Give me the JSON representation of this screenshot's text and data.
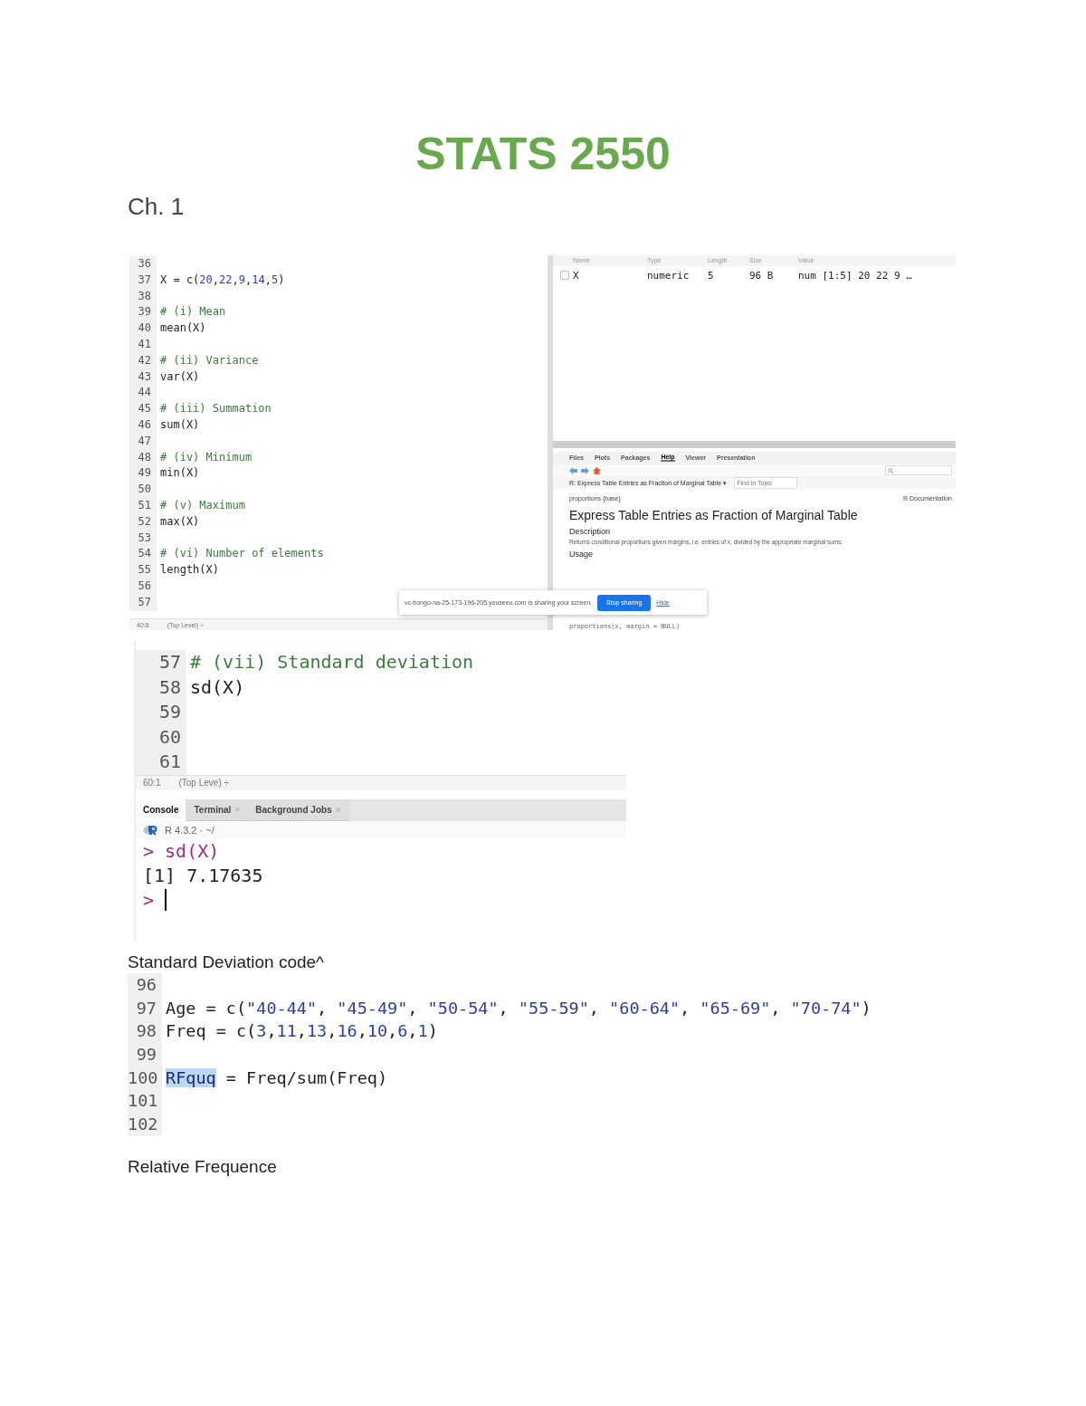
{
  "title": "STATS 2550",
  "chapter": "Ch. 1",
  "shot1": {
    "editor": {
      "lines": [
        {
          "number": "36"
        },
        {
          "number": "37",
          "tokens": [
            {
              "text": "X = c(",
              "kind": "plain"
            },
            {
              "text": "20",
              "kind": "num"
            },
            {
              "text": ",",
              "kind": "plain"
            },
            {
              "text": "22",
              "kind": "num"
            },
            {
              "text": ",",
              "kind": "plain"
            },
            {
              "text": "9",
              "kind": "num"
            },
            {
              "text": ",",
              "kind": "plain"
            },
            {
              "text": "14",
              "kind": "num"
            },
            {
              "text": ",",
              "kind": "plain"
            },
            {
              "text": "5",
              "kind": "num"
            },
            {
              "text": ")",
              "kind": "plain"
            }
          ]
        },
        {
          "number": "38"
        },
        {
          "number": "39",
          "tokens": [
            {
              "text": "# (i) Mean",
              "kind": "comment"
            }
          ]
        },
        {
          "number": "40",
          "tokens": [
            {
              "text": "mean(X)",
              "kind": "plain"
            }
          ]
        },
        {
          "number": "41"
        },
        {
          "number": "42",
          "tokens": [
            {
              "text": "# (ii) Variance",
              "kind": "comment"
            }
          ]
        },
        {
          "number": "43",
          "tokens": [
            {
              "text": "var(X)",
              "kind": "plain"
            }
          ]
        },
        {
          "number": "44"
        },
        {
          "number": "45",
          "tokens": [
            {
              "text": "# (iii) Summation",
              "kind": "comment"
            }
          ]
        },
        {
          "number": "46",
          "tokens": [
            {
              "text": "sum(X)",
              "kind": "plain"
            }
          ]
        },
        {
          "number": "47"
        },
        {
          "number": "48",
          "tokens": [
            {
              "text": "# (iv) Minimum",
              "kind": "comment"
            }
          ]
        },
        {
          "number": "49",
          "tokens": [
            {
              "text": "min(X)",
              "kind": "plain"
            }
          ]
        },
        {
          "number": "50"
        },
        {
          "number": "51",
          "tokens": [
            {
              "text": "# (v) Maximum",
              "kind": "comment"
            }
          ]
        },
        {
          "number": "52",
          "tokens": [
            {
              "text": "max(X)",
              "kind": "plain"
            }
          ]
        },
        {
          "number": "53"
        },
        {
          "number": "54",
          "tokens": [
            {
              "text": "# (vi) Number of elements",
              "kind": "comment"
            }
          ]
        },
        {
          "number": "55",
          "tokens": [
            {
              "text": "length(X)",
              "kind": "plain"
            }
          ]
        },
        {
          "number": "56"
        },
        {
          "number": "57"
        }
      ],
      "position": "40:8",
      "scope": "(Top Level) ÷"
    },
    "environment": {
      "columns": [
        "Name",
        "Type",
        "Length",
        "Size",
        "Value"
      ],
      "rows": [
        {
          "checked": false,
          "cells": [
            "X",
            "numeric",
            "5",
            "96 B",
            "num [1:5] 20 22 9 …"
          ]
        }
      ]
    },
    "pane_tabs": [
      {
        "label": "Files",
        "selected": false
      },
      {
        "label": "Plots",
        "selected": false
      },
      {
        "label": "Packages",
        "selected": false
      },
      {
        "label": "Help",
        "selected": true
      },
      {
        "label": "Viewer",
        "selected": false
      },
      {
        "label": "Presentation",
        "selected": false
      }
    ],
    "help": {
      "topic": "R: Express Table Entries as Fraction of Marginal Table ▾",
      "find_placeholder": "Find in Topic",
      "package": "proportions {base}",
      "doc_label": "R Documentation",
      "heading": "Express Table Entries as Fraction of Marginal Table",
      "description_title": "Description",
      "description": "Returns conditional proportions given margins, i.e. entries of x, divided by the appropriate marginal sums.",
      "usage_title": "Usage",
      "usage": "proportions(x, margin = NULL)"
    },
    "sharing": {
      "message": "vc-bongo-na-25-173-196-205.youseeu.com is sharing your screen.",
      "stop": "Stop sharing",
      "hide": "Hide"
    }
  },
  "shot2": {
    "editor": {
      "lines": [
        {
          "number": "57",
          "tokens": [
            {
              "text": "# (vii) Standard deviation",
              "kind": "comment"
            }
          ]
        },
        {
          "number": "58",
          "tokens": [
            {
              "text": "sd(X)",
              "kind": "plain"
            }
          ]
        },
        {
          "number": "59"
        },
        {
          "number": "60"
        },
        {
          "number": "61"
        }
      ],
      "position": "60:1",
      "scope": "(Top Leve) ÷"
    },
    "console_tabs": [
      {
        "label": "Console",
        "selected": true
      },
      {
        "label": "Terminal",
        "selected": false,
        "close": "×"
      },
      {
        "label": "Background Jobs",
        "selected": false,
        "close": "×"
      }
    ],
    "r_version": "R 4.3.2 · ~/",
    "console": [
      {
        "kind": "input",
        "prompt": ">",
        "text": "sd(X)"
      },
      {
        "kind": "output",
        "text": "[1] 7.17635"
      },
      {
        "kind": "input",
        "prompt": ">"
      }
    ]
  },
  "caption1": "Standard Deviation code^",
  "shot3": {
    "lines": [
      {
        "number": "96"
      },
      {
        "number": "97",
        "tokens": [
          {
            "text": "Age = c(",
            "kind": "plain"
          },
          {
            "text": "\"40-44\"",
            "kind": "str"
          },
          {
            "text": ", ",
            "kind": "plain"
          },
          {
            "text": "\"45-49\"",
            "kind": "str"
          },
          {
            "text": ", ",
            "kind": "plain"
          },
          {
            "text": "\"50-54\"",
            "kind": "str"
          },
          {
            "text": ", ",
            "kind": "plain"
          },
          {
            "text": "\"55-59\"",
            "kind": "str"
          },
          {
            "text": ", ",
            "kind": "plain"
          },
          {
            "text": "\"60-64\"",
            "kind": "str"
          },
          {
            "text": ", ",
            "kind": "plain"
          },
          {
            "text": "\"65-69\"",
            "kind": "str"
          },
          {
            "text": ", ",
            "kind": "plain"
          },
          {
            "text": "\"70-74\"",
            "kind": "str"
          },
          {
            "text": ")",
            "kind": "plain"
          }
        ]
      },
      {
        "number": "98",
        "tokens": [
          {
            "text": "Freq = c(",
            "kind": "plain"
          },
          {
            "text": "3",
            "kind": "num"
          },
          {
            "text": ",",
            "kind": "plain"
          },
          {
            "text": "11",
            "kind": "num"
          },
          {
            "text": ",",
            "kind": "plain"
          },
          {
            "text": "13",
            "kind": "num"
          },
          {
            "text": ",",
            "kind": "plain"
          },
          {
            "text": "16",
            "kind": "num"
          },
          {
            "text": ",",
            "kind": "plain"
          },
          {
            "text": "10",
            "kind": "num"
          },
          {
            "text": ",",
            "kind": "plain"
          },
          {
            "text": "6",
            "kind": "num"
          },
          {
            "text": ",",
            "kind": "plain"
          },
          {
            "text": "1",
            "kind": "num"
          },
          {
            "text": ")",
            "kind": "plain"
          }
        ]
      },
      {
        "number": "99"
      },
      {
        "number": "100",
        "tokens": [
          {
            "text": "RFquq",
            "kind": "highlight"
          },
          {
            "text": " = Freq/sum(Freq)",
            "kind": "plain"
          }
        ]
      },
      {
        "number": "101"
      },
      {
        "number": "102"
      }
    ]
  },
  "caption2": "Relative Frequence"
}
